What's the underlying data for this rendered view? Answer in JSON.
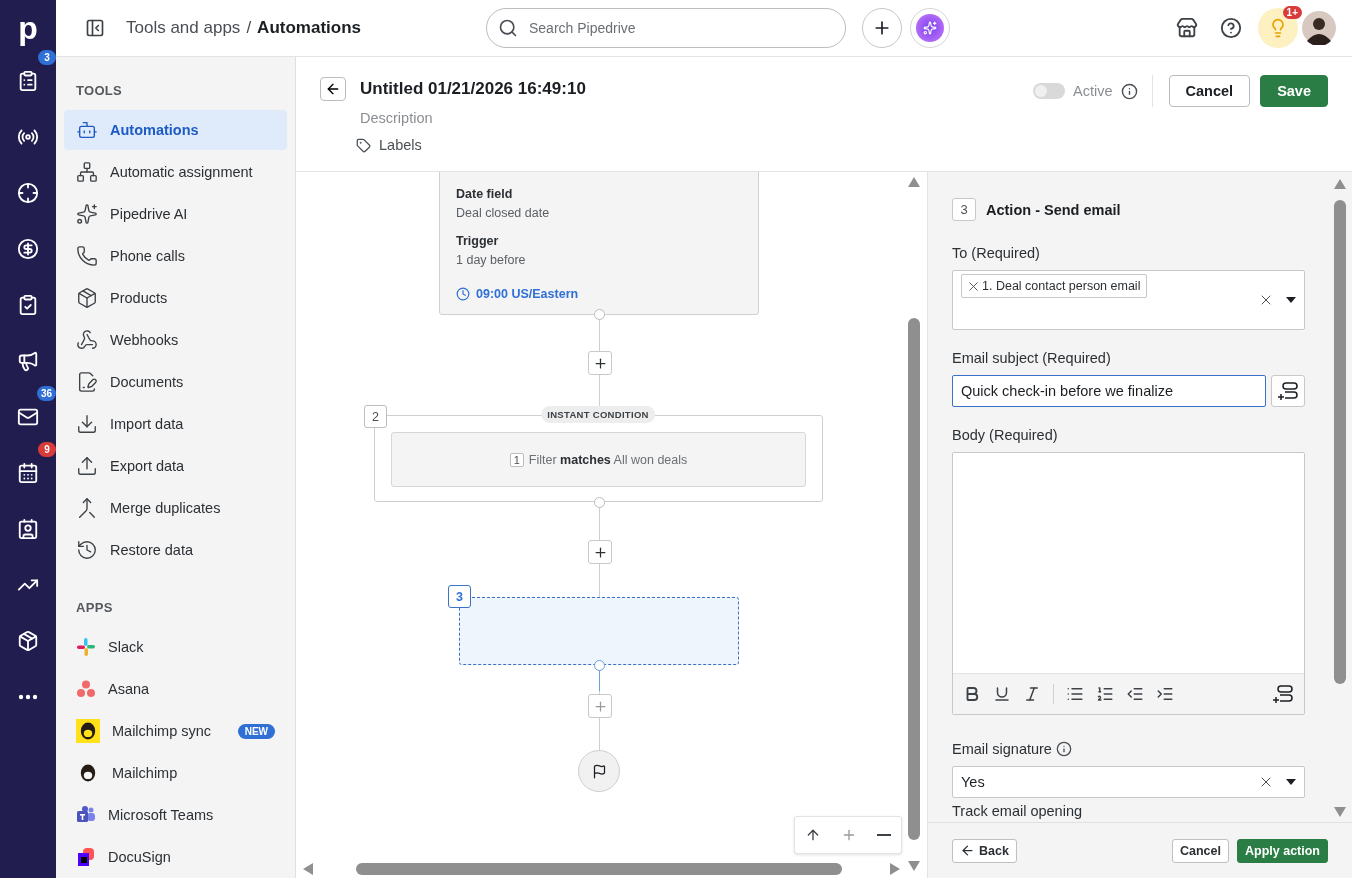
{
  "rail": {
    "logo": "p",
    "items": [
      {
        "selected": false,
        "badge": "3",
        "color": "#2f6fd6"
      },
      {
        "selected": false
      },
      {
        "selected": false
      },
      {
        "selected": false
      },
      {
        "selected": false
      },
      {
        "selected": false
      },
      {
        "selected": false,
        "badge": "36",
        "color": "#2f6fd6"
      },
      {
        "selected": false,
        "badge": "9",
        "color": "#d93b3b"
      },
      {
        "selected": false
      },
      {
        "selected": false
      },
      {
        "selected": false
      },
      {
        "selected": false
      }
    ]
  },
  "topbar": {
    "breadcrumb": {
      "parent": "Tools and apps",
      "separator": "/",
      "current": "Automations"
    },
    "search": {
      "placeholder": "Search Pipedrive"
    },
    "notifications_badge": "1+"
  },
  "sidebar": {
    "sections": [
      {
        "title": "TOOLS",
        "items": [
          {
            "label": "Automations",
            "selected": true
          },
          {
            "label": "Automatic assignment",
            "selected": false
          },
          {
            "label": "Pipedrive AI",
            "selected": false
          },
          {
            "label": "Phone calls",
            "selected": false
          },
          {
            "label": "Products",
            "selected": false
          },
          {
            "label": "Webhooks",
            "selected": false
          },
          {
            "label": "Documents",
            "selected": false
          },
          {
            "label": "Import data",
            "selected": false
          },
          {
            "label": "Export data",
            "selected": false
          },
          {
            "label": "Merge duplicates",
            "selected": false
          },
          {
            "label": "Restore data",
            "selected": false
          }
        ]
      },
      {
        "title": "APPS",
        "items": [
          {
            "label": "Slack",
            "selected": false
          },
          {
            "label": "Asana",
            "selected": false
          },
          {
            "label": "Mailchimp sync",
            "selected": false,
            "badge": "NEW"
          },
          {
            "label": "Mailchimp",
            "selected": false
          },
          {
            "label": "Microsoft Teams",
            "selected": false
          },
          {
            "label": "DocuSign",
            "selected": false
          }
        ]
      }
    ]
  },
  "editor": {
    "title": "Untitled 01/21/2026 16:49:10",
    "description_placeholder": "Description",
    "labels": "Labels",
    "active": {
      "label": "Active",
      "on": false
    },
    "buttons": {
      "cancel": "Cancel",
      "save": "Save"
    }
  },
  "canvas": {
    "trigger": {
      "fields": [
        {
          "label": "Date field",
          "value": "Deal closed date"
        },
        {
          "label": "Trigger",
          "value": "1 day before"
        }
      ],
      "time": "09:00 US/Eastern"
    },
    "condition": {
      "number": "2",
      "tag": "INSTANT CONDITION",
      "filter_number": "1",
      "filter_text": "Filter **matches** All won deals"
    },
    "action": {
      "number": "3",
      "selected": true
    }
  },
  "panel": {
    "step_number": "3",
    "title": "Action - Send email",
    "to": {
      "label": "To (Required)",
      "chips": [
        "1. Deal contact person email"
      ]
    },
    "subject": {
      "label": "Email subject (Required)",
      "value": "Quick check-in before we finalize"
    },
    "body": {
      "label": "Body (Required)"
    },
    "signature": {
      "label": "Email signature",
      "value": "Yes"
    },
    "next_label": "Track email opening",
    "footer": {
      "back": "Back",
      "cancel": "Cancel",
      "apply": "Apply action"
    }
  }
}
